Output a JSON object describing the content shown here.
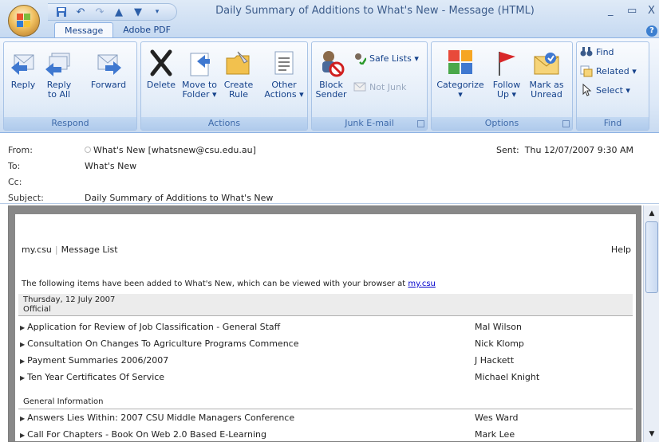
{
  "window": {
    "title": "Daily Summary of Additions to What's New - Message (HTML)",
    "minimize": "_",
    "restore": "▭",
    "close": "X"
  },
  "tabs": [
    "Message",
    "Adobe PDF"
  ],
  "ribbon": {
    "respond": {
      "label": "Respond",
      "reply": "Reply",
      "reply_all_1": "Reply",
      "reply_all_2": "to All",
      "forward": "Forward"
    },
    "actions": {
      "label": "Actions",
      "delete": "Delete",
      "move_1": "Move to",
      "move_2": "Folder ▾",
      "create_1": "Create",
      "create_2": "Rule",
      "other_1": "Other",
      "other_2": "Actions ▾"
    },
    "junk": {
      "label": "Junk E-mail",
      "block_1": "Block",
      "block_2": "Sender",
      "safe_lists": "Safe Lists ▾",
      "not_junk": "Not Junk"
    },
    "options": {
      "label": "Options",
      "categorize_1": "Categorize",
      "categorize_2": "▾",
      "follow_1": "Follow",
      "follow_2": "Up ▾",
      "mark_1": "Mark as",
      "mark_2": "Unread"
    },
    "find": {
      "label": "Find",
      "find": "Find",
      "related": "Related ▾",
      "select": "Select ▾"
    }
  },
  "header": {
    "from_label": "From:",
    "from_value": "What's New [whatsnew@csu.edu.au]",
    "sent_label": "Sent:",
    "sent_value": "Thu 12/07/2007 9:30 AM",
    "to_label": "To:",
    "to_value": "What's New",
    "cc_label": "Cc:",
    "cc_value": "",
    "subject_label": "Subject:",
    "subject_value": "Daily Summary of Additions to What's New"
  },
  "message": {
    "nav_home": "my.csu",
    "nav_sep": "|",
    "nav_list": "Message List",
    "nav_help": "Help",
    "intro_text": "The following items have been added to What's New, which can be viewed with your browser at",
    "intro_link": "my.csu",
    "date": "Thursday, 12 July 2007",
    "sections": [
      {
        "title": "Official",
        "items": [
          {
            "title": "Application for Review of Job Classification - General Staff",
            "author": "Mal Wilson"
          },
          {
            "title": "Consultation On Changes To Agriculture Programs Commence",
            "author": "Nick Klomp"
          },
          {
            "title": "Payment Summaries 2006/2007",
            "author": "J Hackett"
          },
          {
            "title": "Ten Year Certificates Of Service",
            "author": "Michael Knight"
          }
        ]
      },
      {
        "title": "General Information",
        "items": [
          {
            "title": "Answers Lies Within: 2007 CSU Middle Managers Conference",
            "author": "Wes Ward"
          },
          {
            "title": "Call For Chapters - Book On Web 2.0 Based E-Learning",
            "author": "Mark Lee"
          }
        ]
      }
    ]
  },
  "colors": {
    "ribbon_text": "#15428b",
    "link": "#0000cc"
  }
}
